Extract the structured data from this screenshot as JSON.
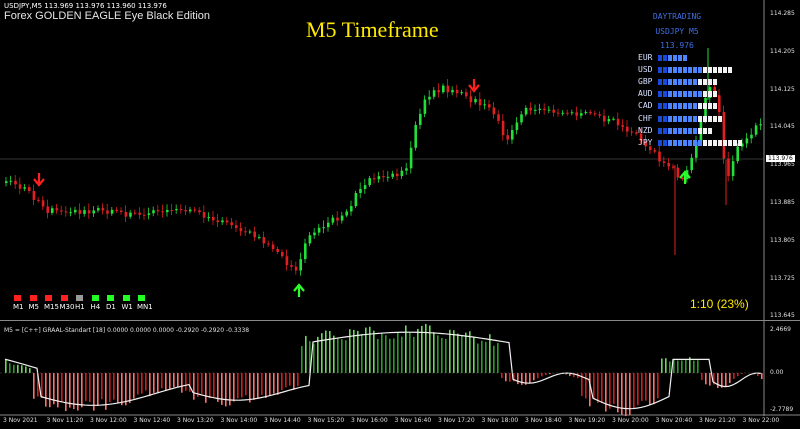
{
  "header": {
    "ohlc": "USDJPY,M5  113.969 113.976 113.960 113.976",
    "ea_name": "Forex GOLDEN EAGLE Eye Black Edition",
    "timeframe_title": "M5 Timeframe",
    "ratio": "1:10 (23%)"
  },
  "dashboard": {
    "line1": "DAYTRADING",
    "line2": "USDJPY M5",
    "line3": "113.976",
    "currencies": [
      {
        "name": "EUR",
        "blue": 6,
        "white": 0
      },
      {
        "name": "USD",
        "blue": 9,
        "white": 6
      },
      {
        "name": "GBP",
        "blue": 8,
        "white": 4
      },
      {
        "name": "AUD",
        "blue": 9,
        "white": 3
      },
      {
        "name": "CAD",
        "blue": 8,
        "white": 4
      },
      {
        "name": "CHF",
        "blue": 8,
        "white": 5
      },
      {
        "name": "NZD",
        "blue": 8,
        "white": 3
      },
      {
        "name": "JPY",
        "blue": 9,
        "white": 8
      }
    ]
  },
  "timeframes": [
    {
      "label": "M1",
      "color": "#ff2020"
    },
    {
      "label": "M5",
      "color": "#ff2020"
    },
    {
      "label": "M15",
      "color": "#ff2020"
    },
    {
      "label": "M30",
      "color": "#ff2020"
    },
    {
      "label": "H1",
      "color": "#9a9a9a"
    },
    {
      "label": "H4",
      "color": "#22ff22"
    },
    {
      "label": "D1",
      "color": "#22ff22"
    },
    {
      "label": "W1",
      "color": "#22ff22"
    },
    {
      "label": "MN1",
      "color": "#22ff22"
    }
  ],
  "price_axis": [
    "114.285",
    "114.205",
    "114.125",
    "114.045",
    "113.965",
    "113.885",
    "113.805",
    "113.725",
    "113.645"
  ],
  "current_price": "113.976",
  "time_axis": [
    "3 Nov 2021",
    "3 Nov 11:20",
    "3 Nov 12:00",
    "3 Nov 12:40",
    "3 Nov 13:20",
    "3 Nov 14:00",
    "3 Nov 14:40",
    "3 Nov 15:20",
    "3 Nov 16:00",
    "3 Nov 16:40",
    "3 Nov 17:20",
    "3 Nov 18:00",
    "3 Nov 18:40",
    "3 Nov 19:20",
    "3 Nov 20:00",
    "3 Nov 20:40",
    "3 Nov 21:20",
    "3 Nov 22:00"
  ],
  "oscillator": {
    "label": "M5 = [C++] GRAAL-Standart [18] 0.0000 0.0000 0.0000 -0.2920 -0.2920 -0.3338",
    "axis": [
      "2.4669",
      "0.00",
      "-2.7789"
    ]
  },
  "colors": {
    "bull": "#22e03a",
    "bear": "#e02020",
    "arrow_up": "#2aff2a",
    "arrow_down": "#ff2020",
    "accent_yellow": "#ffea00"
  }
}
